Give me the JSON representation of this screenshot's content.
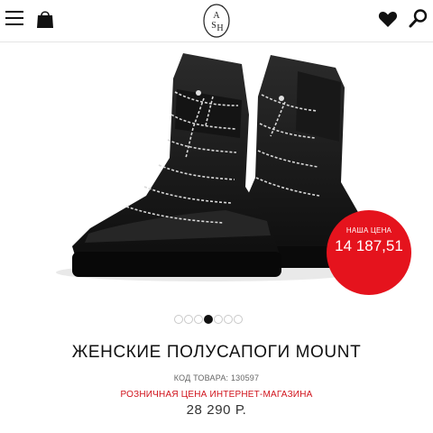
{
  "header": {
    "menu_icon": "hamburger-menu-icon",
    "cart_icon": "shopping-bag-icon",
    "logo_icon": "ash-logo",
    "logo_text": "ASH",
    "wishlist_icon": "heart-icon",
    "search_icon": "search-icon"
  },
  "product": {
    "title": "ЖЕНСКИЕ ПОЛУСАПОГИ MOUNT",
    "sku_label": "КОД ТОВАРА:",
    "sku_value": "130597",
    "retail_label": "РОЗНИЧНАЯ ЦЕНА ИНТЕРНЕТ-МАГАЗИНА",
    "retail_price": "28 290 Р."
  },
  "badge": {
    "label": "НАША ЦЕНА",
    "price": "14 187,51",
    "color": "#e5131d"
  },
  "gallery": {
    "image": "black-platform-winter-boots",
    "dot_count": 7,
    "active_index": 3
  }
}
